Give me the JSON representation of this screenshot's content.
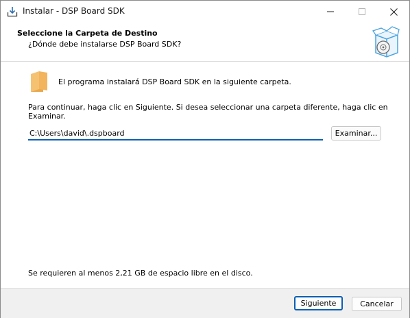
{
  "window": {
    "title": "Instalar - DSP Board SDK",
    "icons": {
      "app": "installer-download-icon",
      "minimize": "minimize-icon",
      "maximize": "maximize-icon",
      "close": "close-icon"
    }
  },
  "header": {
    "title": "Seleccione la Carpeta de Destino",
    "subtitle": "¿Dónde debe instalarse DSP Board SDK?",
    "icon": "software-box-disc-icon"
  },
  "content": {
    "folder_icon": "folder-icon",
    "info": "El programa instalará DSP Board SDK en la siguiente carpeta.",
    "instructions": "Para continuar, haga clic en Siguiente. Si desea seleccionar una carpeta diferente, haga clic en Examinar.",
    "path_value": "C:\\Users\\david\\.dspboard",
    "browse_label": "Examinar...",
    "space_required": "Se requieren al menos 2,21 GB de espacio libre en el disco."
  },
  "footer": {
    "next_label": "Siguiente",
    "cancel_label": "Cancelar"
  },
  "colors": {
    "accent": "#0a5fb4",
    "window_bg": "#f0f0f0",
    "panel_bg": "#ffffff",
    "folder": "#f2b45c",
    "box": "#4aa3df"
  }
}
